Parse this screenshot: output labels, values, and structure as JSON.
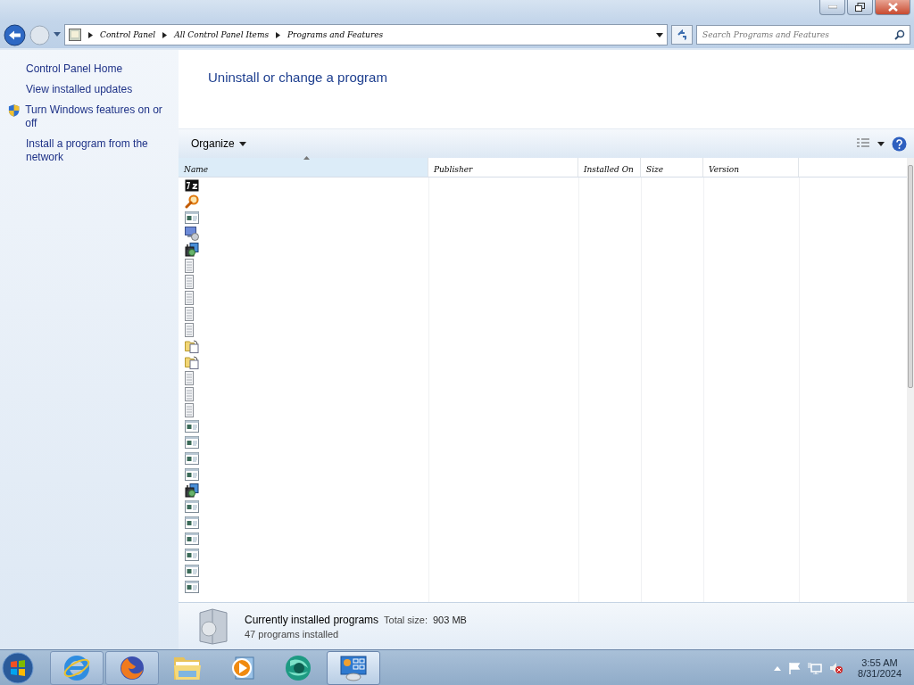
{
  "address_bar": {
    "breadcrumbs": [
      "Control Panel",
      "All Control Panel Items",
      "Programs and Features"
    ]
  },
  "search": {
    "placeholder": "Search Programs and Features"
  },
  "sidebar": {
    "links": [
      {
        "label": "Control Panel Home",
        "kind": "link"
      },
      {
        "label": "View installed updates",
        "kind": "link"
      },
      {
        "label": "Turn Windows features on or off",
        "kind": "shield-link"
      },
      {
        "label": "Install a program from the network",
        "kind": "link"
      }
    ]
  },
  "main": {
    "title": "Uninstall or change a program"
  },
  "toolbar": {
    "organize": "Organize"
  },
  "table": {
    "columns": [
      {
        "label": "Name",
        "sorted": true
      },
      {
        "label": "Publisher",
        "sorted": false
      },
      {
        "label": "Installed On",
        "sorted": false
      },
      {
        "label": "Size",
        "sorted": false
      },
      {
        "label": "Version",
        "sorted": false
      }
    ],
    "rows": [
      {
        "kind": "archive"
      },
      {
        "kind": "magnifier"
      },
      {
        "kind": "window"
      },
      {
        "kind": "monitor"
      },
      {
        "kind": "installer"
      },
      {
        "kind": "document"
      },
      {
        "kind": "document"
      },
      {
        "kind": "document"
      },
      {
        "kind": "document"
      },
      {
        "kind": "document"
      },
      {
        "kind": "folder"
      },
      {
        "kind": "folder"
      },
      {
        "kind": "document"
      },
      {
        "kind": "document"
      },
      {
        "kind": "document"
      },
      {
        "kind": "window"
      },
      {
        "kind": "window"
      },
      {
        "kind": "window"
      },
      {
        "kind": "window"
      },
      {
        "kind": "installer"
      },
      {
        "kind": "window"
      },
      {
        "kind": "window"
      },
      {
        "kind": "window"
      },
      {
        "kind": "window"
      },
      {
        "kind": "window"
      },
      {
        "kind": "window"
      }
    ]
  },
  "details": {
    "title": "Currently installed programs",
    "total_label": "Total size:",
    "total": "903 MB",
    "count": "47 programs installed"
  },
  "taskbar": {
    "apps": [
      {
        "kind": "browser-e",
        "running": true,
        "selected": false
      },
      {
        "kind": "browser-fox",
        "running": true,
        "selected": false
      },
      {
        "kind": "folder",
        "running": false,
        "selected": false
      },
      {
        "kind": "media",
        "running": false,
        "selected": false
      },
      {
        "kind": "globe",
        "running": false,
        "selected": false
      },
      {
        "kind": "control-panel",
        "running": true,
        "selected": true
      }
    ],
    "time": "3:55 AM",
    "date": "8/31/2024"
  }
}
